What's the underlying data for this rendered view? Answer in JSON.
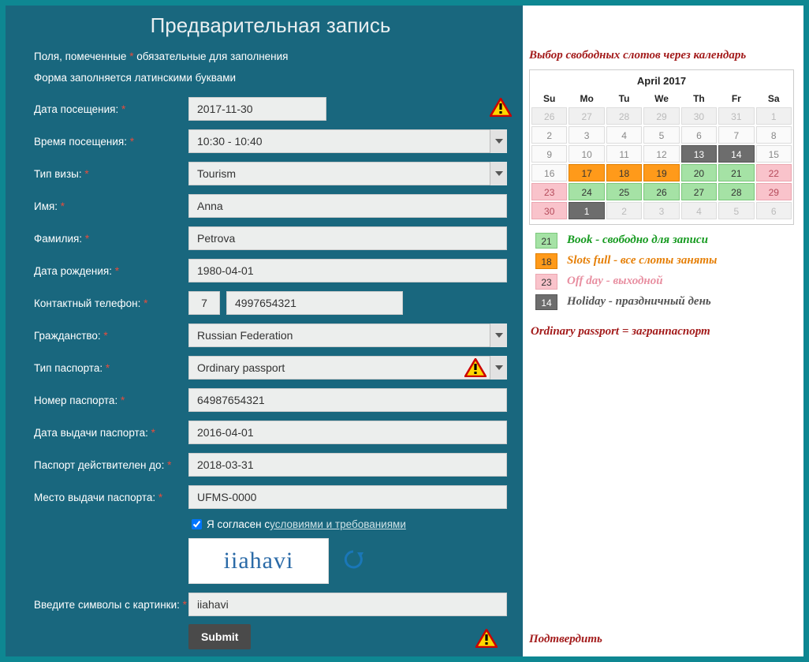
{
  "title": "Предварительная запись",
  "note_required_pre": "Поля, помеченные ",
  "note_required_post": " обязательные для заполнения",
  "note_latin": "Форма заполняется латинскими буквами",
  "star": "*",
  "labels": {
    "visit_date": "Дата посещения: ",
    "visit_time": "Время посещения: ",
    "visa_type": "Тип визы: ",
    "first_name": "Имя: ",
    "last_name": "Фамилия: ",
    "dob": "Дата рождения: ",
    "phone": "Контактный телефон: ",
    "citizenship": "Гражданство: ",
    "passport_type": "Тип паспорта: ",
    "passport_no": "Номер паспорта: ",
    "passport_issue": "Дата выдачи паспорта: ",
    "passport_expiry": "Паспорт действителен до: ",
    "passport_place": "Место выдачи паспорта: ",
    "captcha": "Введите символы с картинки: "
  },
  "values": {
    "visit_date": "2017-11-30",
    "visit_time": "10:30 - 10:40",
    "visa_type": "Tourism",
    "first_name": "Anna",
    "last_name": "Petrova",
    "dob": "1980-04-01",
    "phone_code": "7",
    "phone_num": "4997654321",
    "citizenship": "Russian Federation",
    "passport_type": "Ordinary passport",
    "passport_no": "64987654321",
    "passport_issue": "2016-04-01",
    "passport_expiry": "2018-03-31",
    "passport_place": "UFMS-0000",
    "captcha_input": "iiahavi",
    "captcha_image": "iiahavi"
  },
  "consent_pre": "Я согласен с ",
  "consent_link": "условиями и требованиями",
  "submit_label": "Submit",
  "annotations": {
    "header": "Выбор свободных слотов через календарь",
    "passport": "Ordinary passport = загранпаспорт",
    "submit": "Подтвердить"
  },
  "calendar": {
    "title": "April 2017",
    "dow": [
      "Su",
      "Mo",
      "Tu",
      "We",
      "Th",
      "Fr",
      "Sa"
    ],
    "cells": [
      {
        "n": "26",
        "c": "other"
      },
      {
        "n": "27",
        "c": "other"
      },
      {
        "n": "28",
        "c": "other"
      },
      {
        "n": "29",
        "c": "other"
      },
      {
        "n": "30",
        "c": "other"
      },
      {
        "n": "31",
        "c": "other"
      },
      {
        "n": "1",
        "c": "other"
      },
      {
        "n": "2",
        "c": ""
      },
      {
        "n": "3",
        "c": ""
      },
      {
        "n": "4",
        "c": ""
      },
      {
        "n": "5",
        "c": ""
      },
      {
        "n": "6",
        "c": ""
      },
      {
        "n": "7",
        "c": ""
      },
      {
        "n": "8",
        "c": ""
      },
      {
        "n": "9",
        "c": ""
      },
      {
        "n": "10",
        "c": ""
      },
      {
        "n": "11",
        "c": ""
      },
      {
        "n": "12",
        "c": ""
      },
      {
        "n": "13",
        "c": "hol"
      },
      {
        "n": "14",
        "c": "hol"
      },
      {
        "n": "15",
        "c": ""
      },
      {
        "n": "16",
        "c": ""
      },
      {
        "n": "17",
        "c": "full"
      },
      {
        "n": "18",
        "c": "full"
      },
      {
        "n": "19",
        "c": "full"
      },
      {
        "n": "20",
        "c": "book"
      },
      {
        "n": "21",
        "c": "book"
      },
      {
        "n": "22",
        "c": "off"
      },
      {
        "n": "23",
        "c": "off"
      },
      {
        "n": "24",
        "c": "book"
      },
      {
        "n": "25",
        "c": "book"
      },
      {
        "n": "26",
        "c": "book"
      },
      {
        "n": "27",
        "c": "book"
      },
      {
        "n": "28",
        "c": "book"
      },
      {
        "n": "29",
        "c": "off"
      },
      {
        "n": "30",
        "c": "off"
      },
      {
        "n": "1",
        "c": "hol"
      },
      {
        "n": "2",
        "c": "other"
      },
      {
        "n": "3",
        "c": "other"
      },
      {
        "n": "4",
        "c": "other"
      },
      {
        "n": "5",
        "c": "other"
      },
      {
        "n": "6",
        "c": "other"
      }
    ]
  },
  "legend": {
    "book": {
      "key": "21",
      "text": "Book - свободно для записи"
    },
    "full": {
      "key": "18",
      "text": "Slots full - все слоты заняты"
    },
    "off": {
      "key": "23",
      "text": "Off day - выходной"
    },
    "hol": {
      "key": "14",
      "text": "Holiday - праздничный день"
    }
  }
}
